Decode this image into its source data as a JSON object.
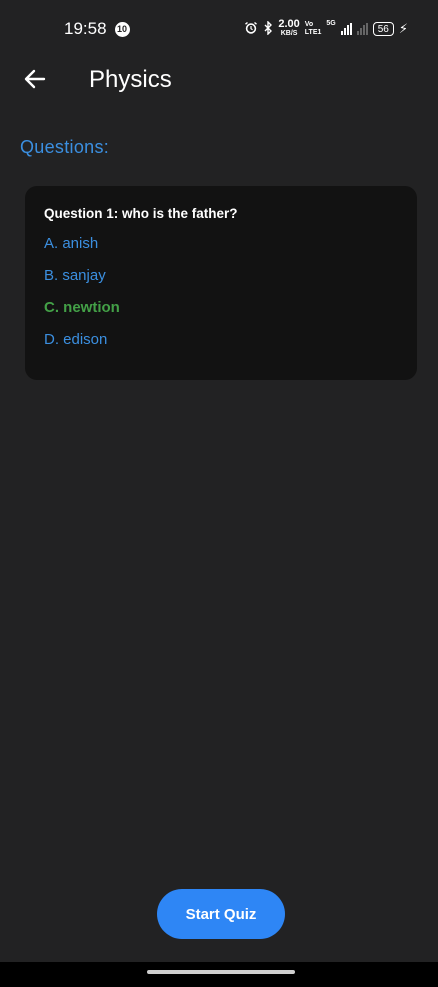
{
  "status_bar": {
    "time": "19:58",
    "notification_count": "10",
    "net_speed_value": "2.00",
    "net_speed_unit": "KB/S",
    "volte_top": "Vo",
    "volte_bottom": "LTE1",
    "network_type": "5G",
    "battery_level": "56"
  },
  "app_bar": {
    "title": "Physics"
  },
  "main": {
    "section_heading": "Questions:",
    "question": {
      "text": "Question 1: who is the father?",
      "options": [
        {
          "label": "A. anish",
          "correct": false
        },
        {
          "label": "B. sanjay",
          "correct": false
        },
        {
          "label": "C. newtion",
          "correct": true
        },
        {
          "label": "D. edison",
          "correct": false
        }
      ]
    }
  },
  "footer": {
    "start_button_label": "Start Quiz"
  },
  "colors": {
    "background": "#222223",
    "card": "#121212",
    "accent_blue": "#3b8fe0",
    "correct_green": "#43a047",
    "button_blue": "#2e86f5"
  },
  "icons": {
    "back": "arrow-left-icon",
    "alarm": "alarm-icon",
    "bluetooth": "bluetooth-icon",
    "battery": "battery-icon",
    "charging": "bolt-icon"
  }
}
